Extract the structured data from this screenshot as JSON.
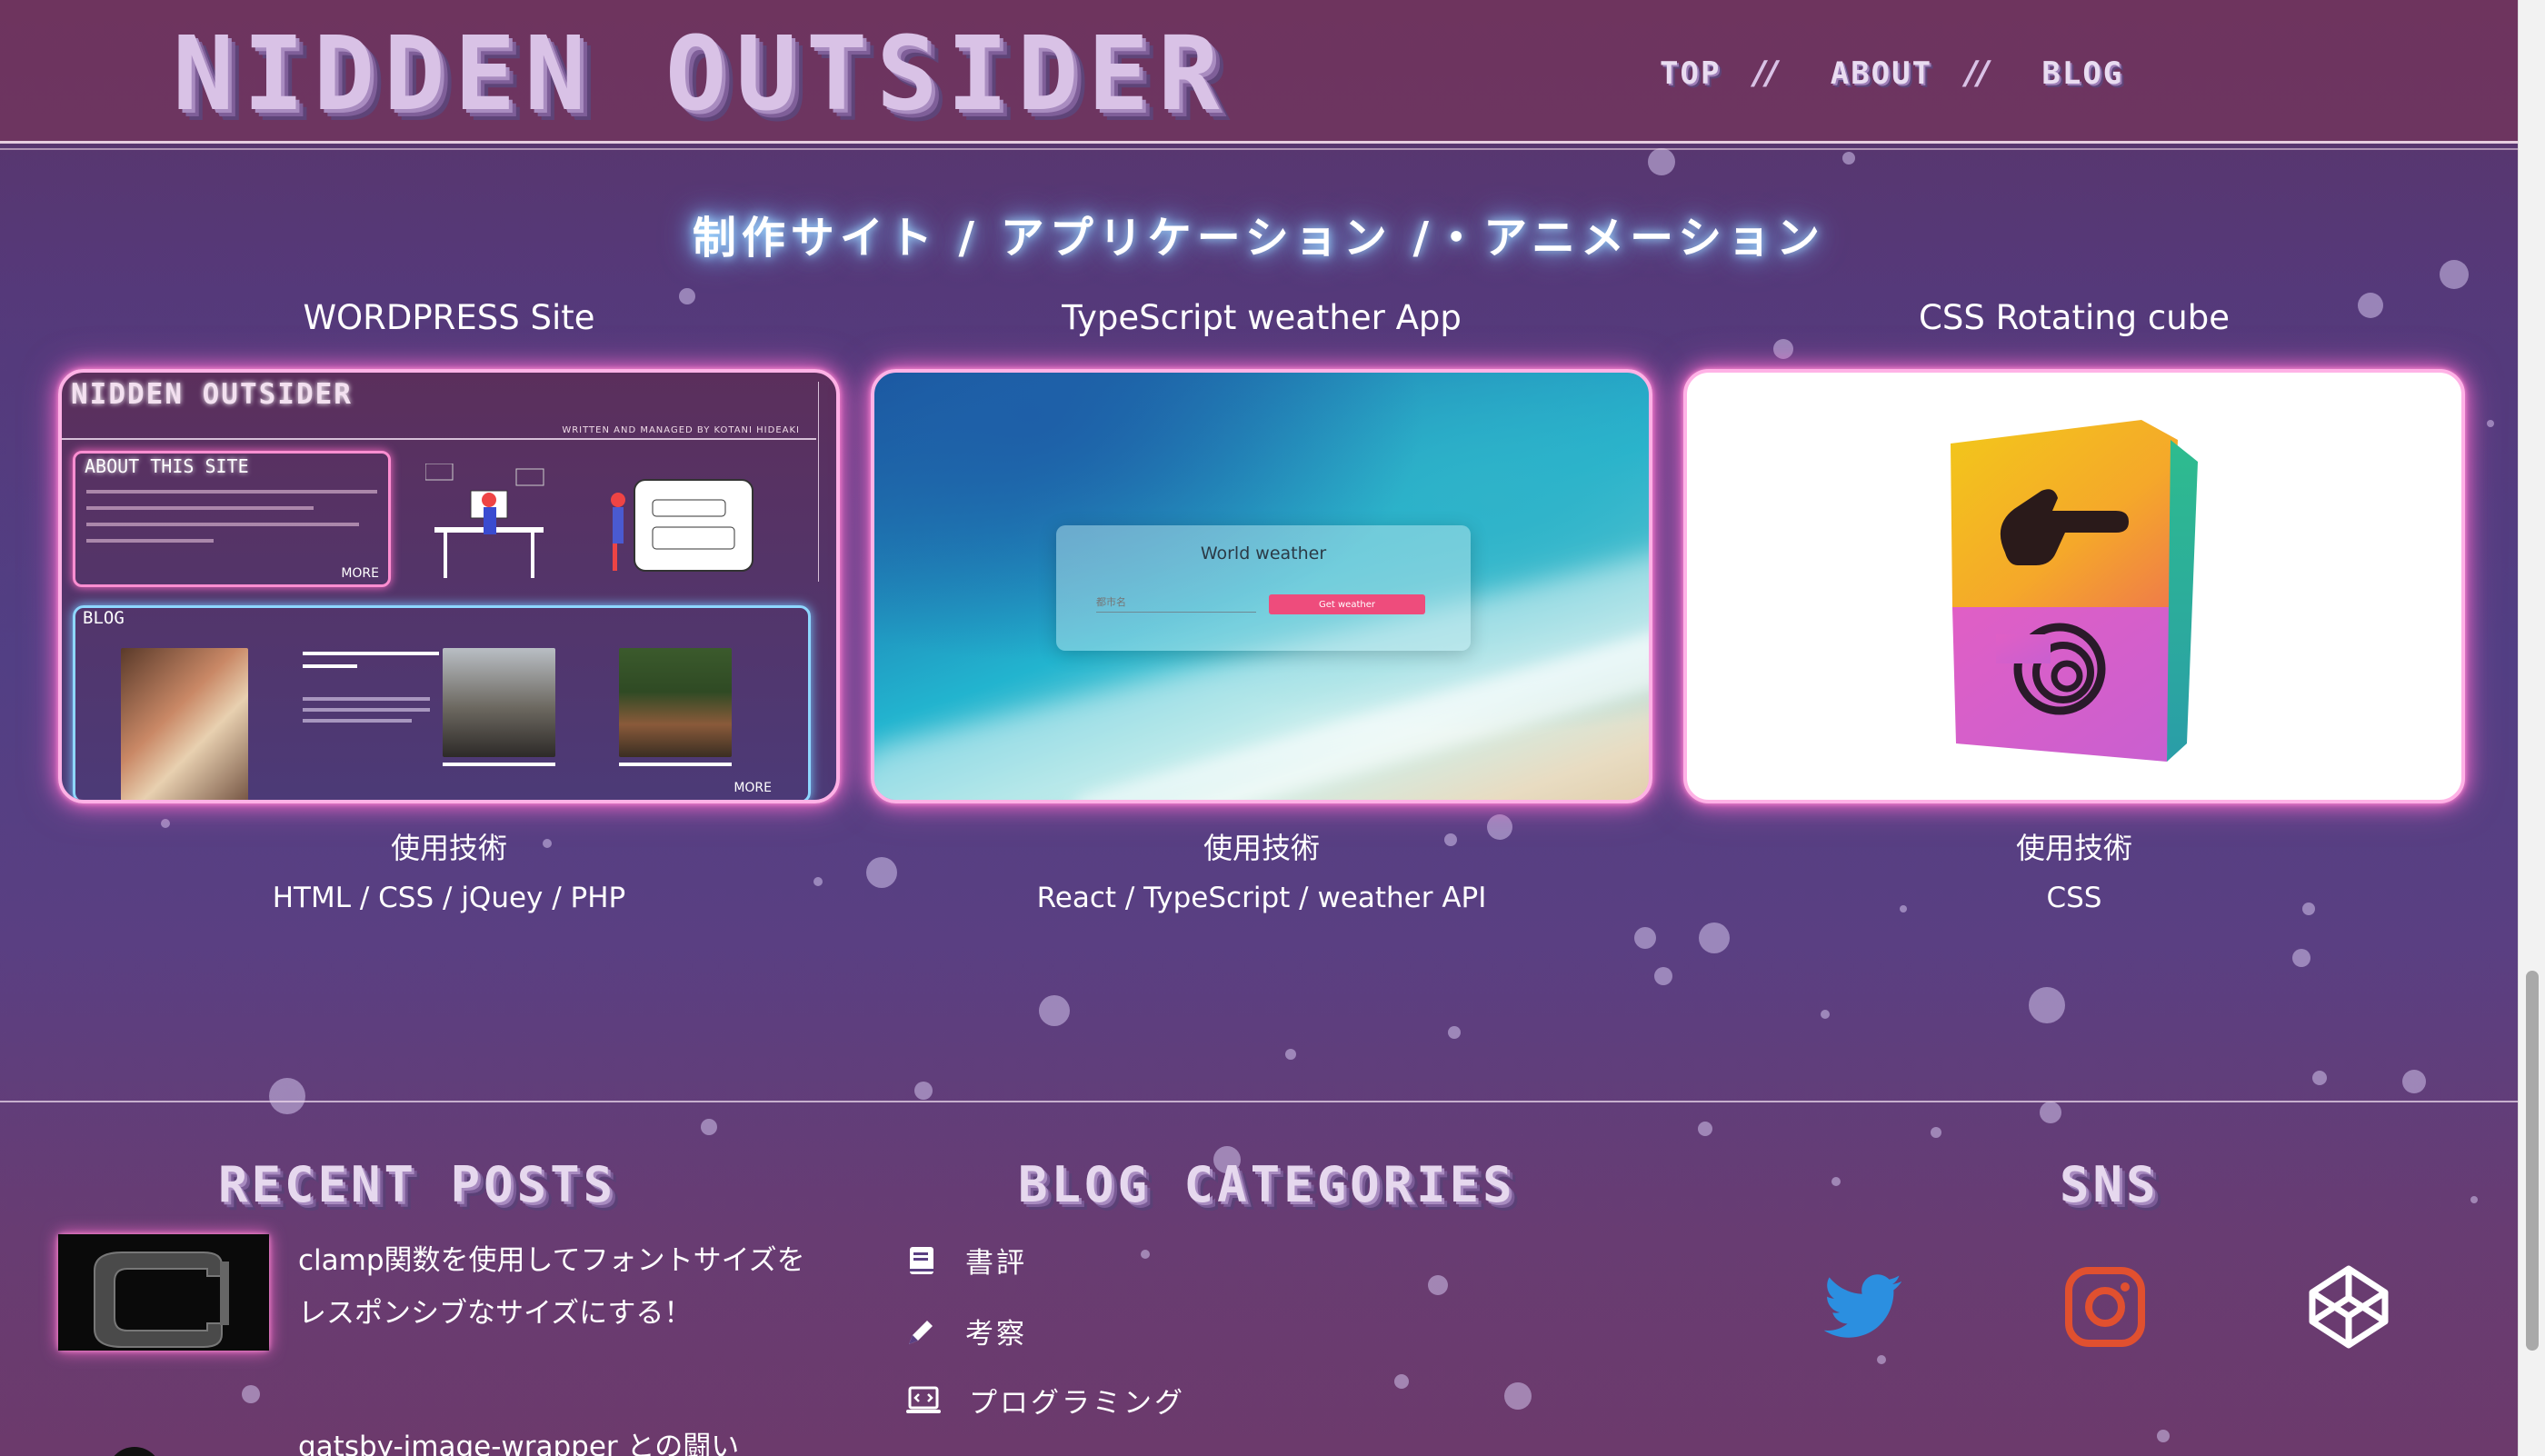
{
  "header": {
    "logo": "NIDDEN OUTSIDER",
    "nav": [
      {
        "label": "TOP"
      },
      {
        "label": "ABOUT"
      },
      {
        "label": "BLOG"
      }
    ],
    "separator": "//"
  },
  "works": {
    "title": "制作サイト / アプリケーション /・アニメーション",
    "tech_heading": "使用技術",
    "items": [
      {
        "title": "WORDPRESS Site",
        "tech": "HTML / CSS / jQuey / PHP"
      },
      {
        "title": "TypeScript weather App",
        "tech": "React / TypeScript / weather API"
      },
      {
        "title": "CSS Rotating cube",
        "tech": "CSS"
      }
    ]
  },
  "wp_preview": {
    "logo": "NIDDEN OUTSIDER",
    "subtitle": "WRITTEN AND MANAGED BY KOTANI HIDEAKI",
    "about_title": "ABOUT THIS SITE",
    "blog_title": "BLOG",
    "more": "MORE"
  },
  "weather_preview": {
    "panel_title": "World weather",
    "input_placeholder": "都市名",
    "button_label": "Get weather"
  },
  "footer": {
    "recent_posts_heading": "RECENT POSTS",
    "categories_heading": "BLOG CATEGORIES",
    "sns_heading": "SNS",
    "posts": [
      {
        "title": "clamp関数を使用してフォントサイズをレスポンシブなサイズにする！"
      },
      {
        "title": "gatsby-image-wrapper との闘い"
      }
    ],
    "categories": [
      {
        "label": "書評",
        "icon": "book-icon"
      },
      {
        "label": "考察",
        "icon": "pencil-icon"
      },
      {
        "label": "プログラミング",
        "icon": "laptop-code-icon"
      }
    ],
    "sns": [
      {
        "name": "twitter-icon",
        "color": "#1da1f2"
      },
      {
        "name": "instagram-icon",
        "color": "#e1502f"
      },
      {
        "name": "codepen-icon",
        "color": "#ffffff"
      }
    ]
  }
}
